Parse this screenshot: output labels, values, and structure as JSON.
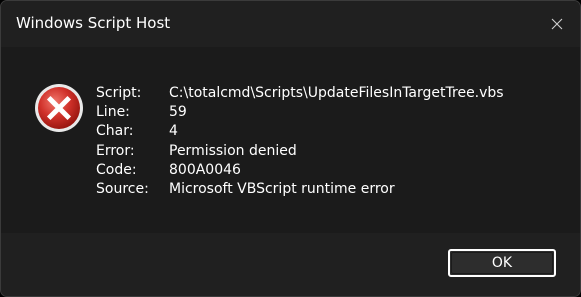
{
  "window": {
    "title": "Windows Script Host"
  },
  "icon": {
    "type": "error-icon",
    "color": "#c42b1c"
  },
  "details": [
    {
      "label": "Script:",
      "value": "C:\\totalcmd\\Scripts\\UpdateFilesInTargetTree.vbs"
    },
    {
      "label": "Line:",
      "value": "59"
    },
    {
      "label": "Char:",
      "value": "4"
    },
    {
      "label": "Error:",
      "value": "Permission denied"
    },
    {
      "label": "Code:",
      "value": "800A0046"
    },
    {
      "label": "Source:",
      "value": "Microsoft VBScript runtime error"
    }
  ],
  "buttons": {
    "ok_label": "OK"
  }
}
